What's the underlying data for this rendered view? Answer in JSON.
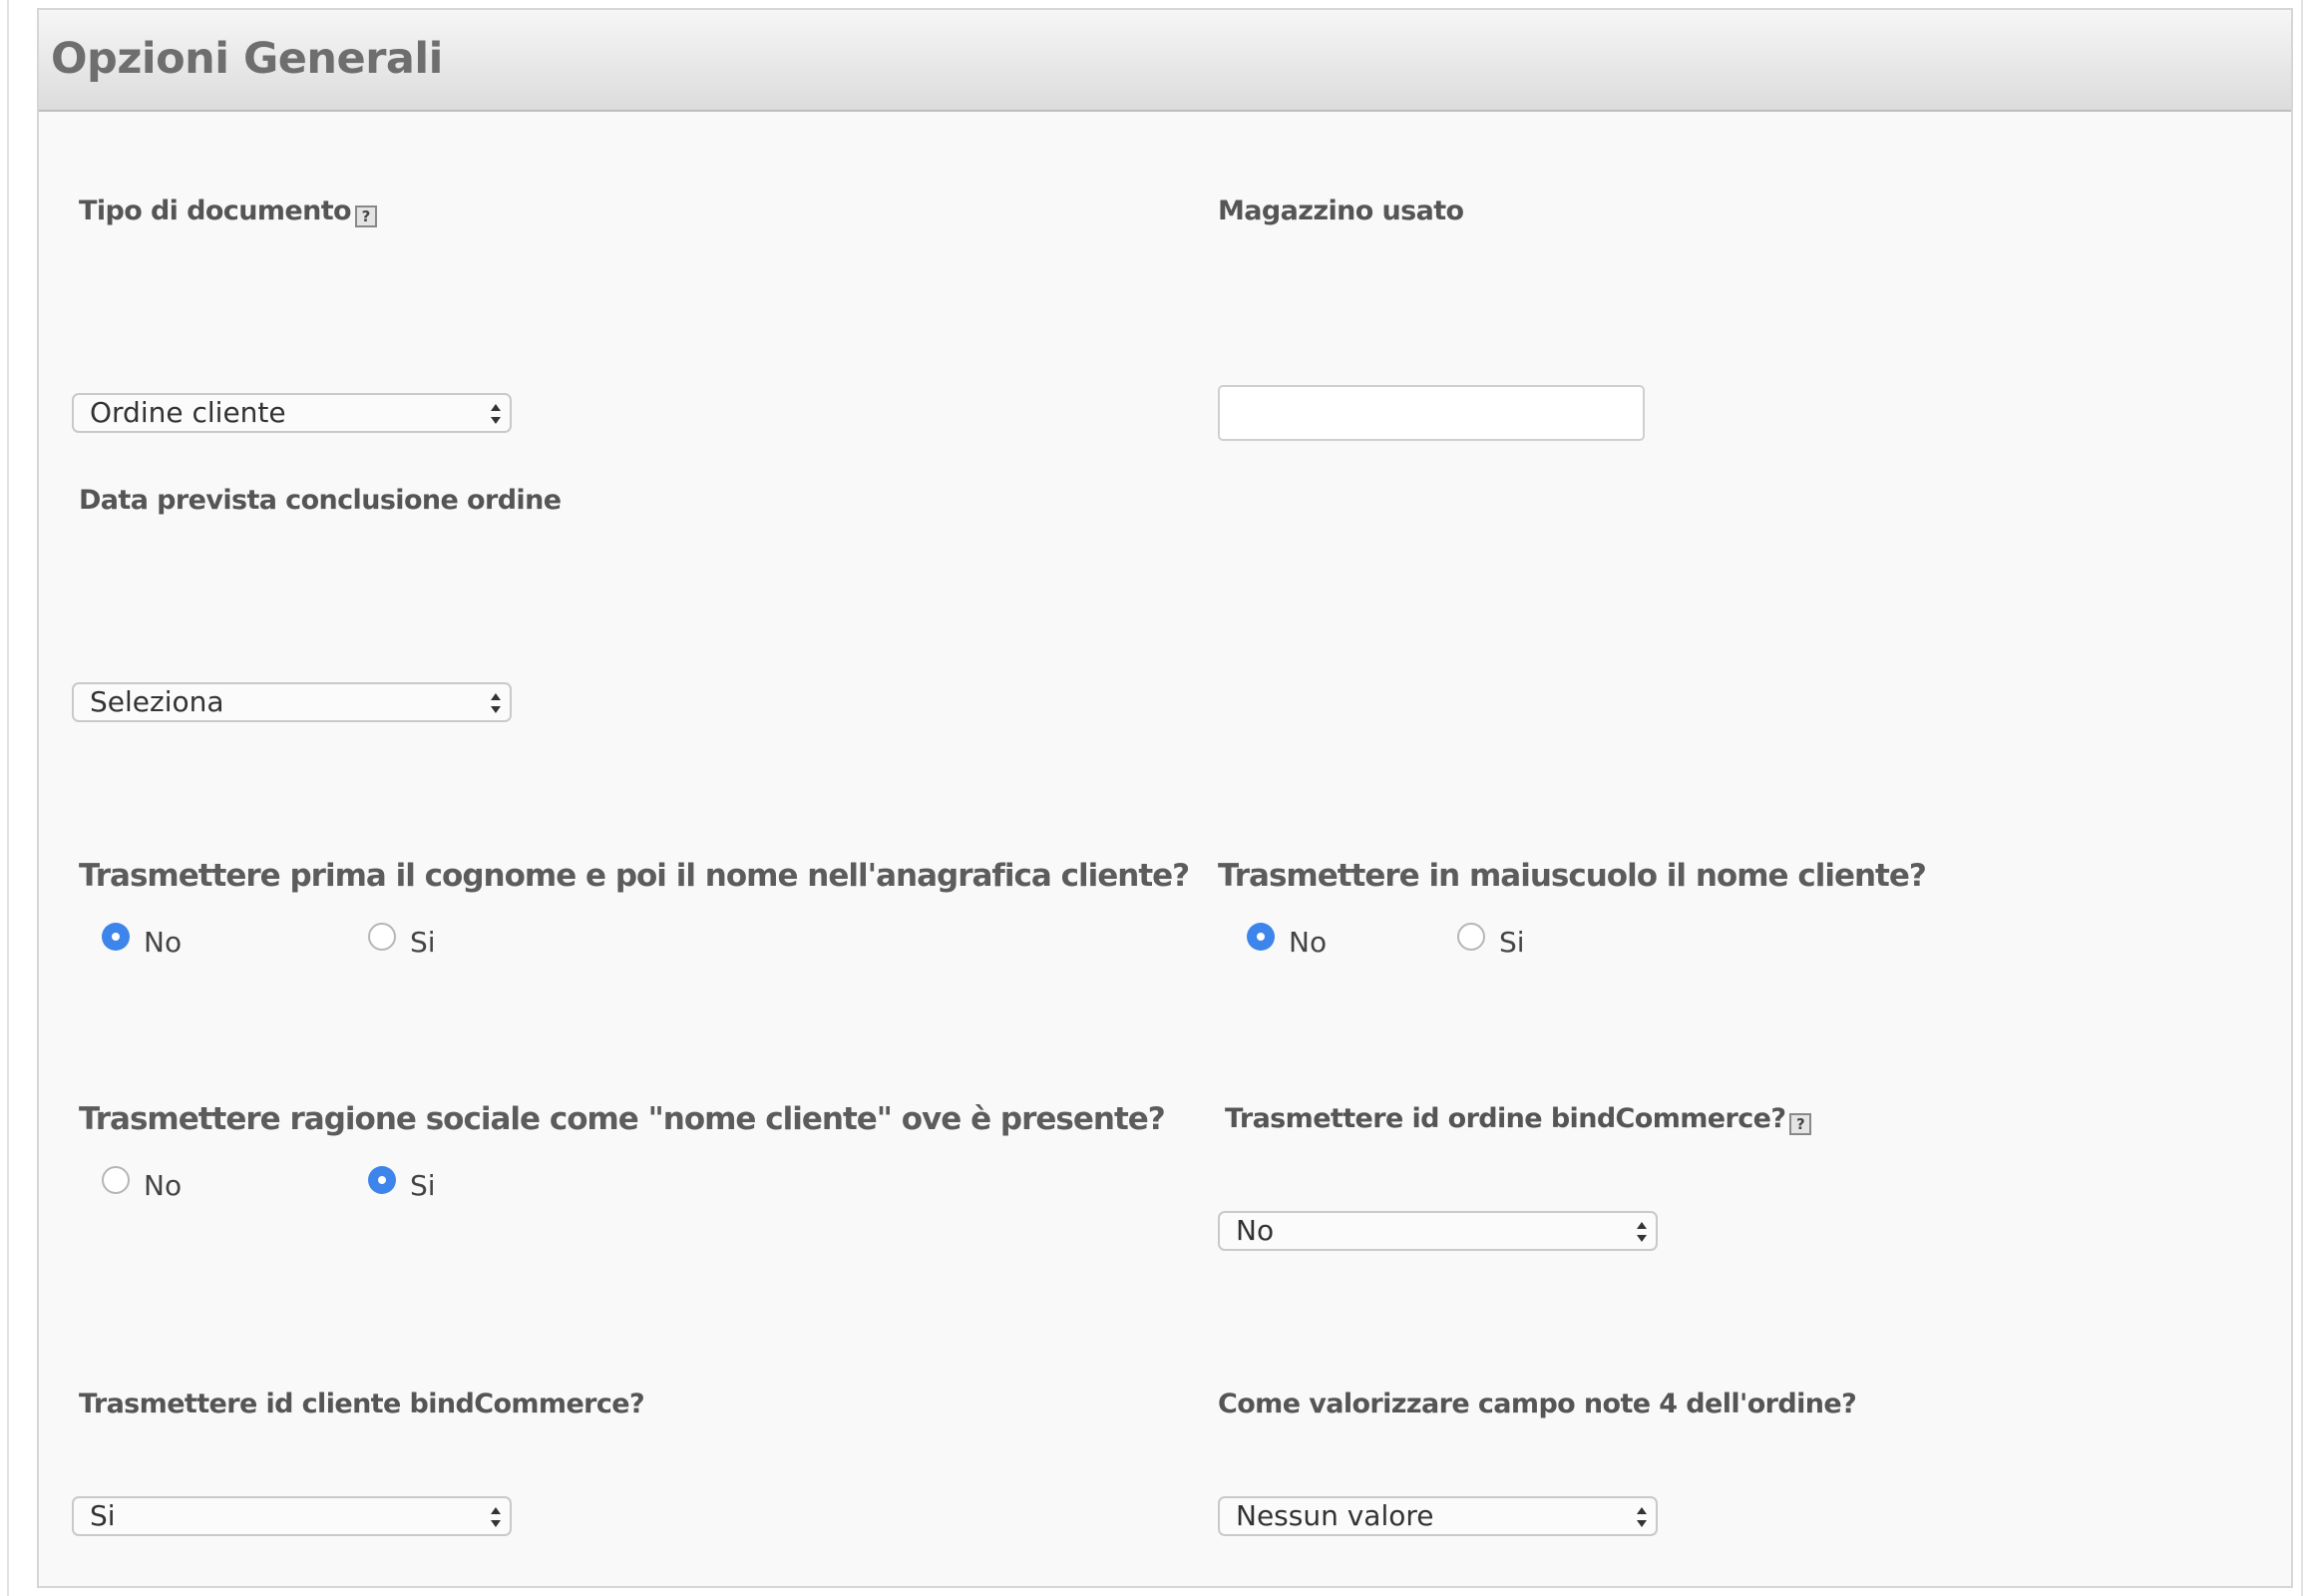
{
  "panel": {
    "title": "Opzioni Generali"
  },
  "fields": {
    "tipo_documento": {
      "label": "Tipo di documento",
      "value": "Ordine cliente"
    },
    "magazzino": {
      "label": "Magazzino usato",
      "value": ""
    },
    "data_prevista": {
      "label": "Data prevista conclusione ordine",
      "value": "Seleziona"
    },
    "cognome_nome": {
      "label": "Trasmettere prima il cognome e poi il nome nell'anagrafica cliente?",
      "options": [
        "No",
        "Si"
      ],
      "selected": "No"
    },
    "maiuscolo": {
      "label": "Trasmettere in maiuscuolo il nome cliente?",
      "options": [
        "No",
        "Si"
      ],
      "selected": "No"
    },
    "ragione_sociale": {
      "label": "Trasmettere ragione sociale come \"nome cliente\" ove è presente?",
      "options": [
        "No",
        "Si"
      ],
      "selected": "Si"
    },
    "id_ordine": {
      "label": "Trasmettere id ordine bindCommerce?",
      "value": "No"
    },
    "id_cliente": {
      "label": "Trasmettere id cliente bindCommerce?",
      "value": "Si"
    },
    "note4": {
      "label": "Come valorizzare campo note 4 dell'ordine?",
      "value": "Nessun valore"
    }
  },
  "icons": {
    "help": "?",
    "radio_selected_color": "#3d85ea"
  }
}
